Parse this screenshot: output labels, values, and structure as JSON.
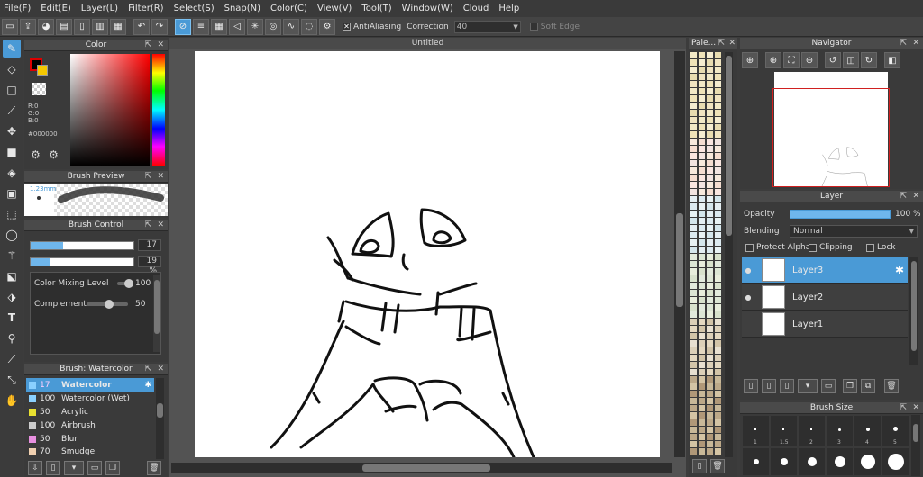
{
  "menu": [
    "File(F)",
    "Edit(E)",
    "Layer(L)",
    "Filter(R)",
    "Select(S)",
    "Snap(N)",
    "Color(C)",
    "View(V)",
    "Tool(T)",
    "Window(W)",
    "Cloud",
    "Help"
  ],
  "toolbar": {
    "antialiasing_label": "AntiAliasing",
    "correction_label": "Correction",
    "correction_value": "40",
    "soft_edge_label": "Soft Edge"
  },
  "color_panel": {
    "title": "Color",
    "r": "R:0",
    "g": "G:0",
    "b": "B:0",
    "hex": "#000000"
  },
  "brush_preview": {
    "title": "Brush Preview",
    "size_label": "1.23mm"
  },
  "brush_control": {
    "title": "Brush Control",
    "size_value": "17",
    "opacity_value": "19 %",
    "size_fraction": 0.32,
    "opacity_fraction": 0.19,
    "mixing_label": "Color Mixing Level",
    "mixing_value": "100",
    "complement_label": "Complement",
    "complement_value": "50"
  },
  "brush_list": {
    "title": "Brush: Watercolor",
    "items": [
      {
        "size": "17",
        "name": "Watercolor",
        "color": "#8ad0ff",
        "selected": true
      },
      {
        "size": "100",
        "name": "Watercolor (Wet)",
        "color": "#8ad0ff",
        "selected": false
      },
      {
        "size": "50",
        "name": "Acrylic",
        "color": "#e8e030",
        "selected": false
      },
      {
        "size": "100",
        "name": "Airbrush",
        "color": "#cccccc",
        "selected": false
      },
      {
        "size": "50",
        "name": "Blur",
        "color": "#e890e0",
        "selected": false
      },
      {
        "size": "70",
        "name": "Smudge",
        "color": "#f0d0b0",
        "selected": false
      }
    ]
  },
  "canvas": {
    "title": "Untitled"
  },
  "palette": {
    "title": "Pale..."
  },
  "navigator": {
    "title": "Navigator"
  },
  "layer_panel": {
    "title": "Layer",
    "opacity_label": "Opacity",
    "opacity_value": "100 %",
    "opacity_fraction": 1.0,
    "blending_label": "Blending",
    "blending_value": "Normal",
    "protect_alpha": "Protect Alpha",
    "clipping": "Clipping",
    "lock": "Lock",
    "layers": [
      "Layer3",
      "Layer2",
      "Layer1"
    ]
  },
  "brush_size": {
    "title": "Brush Size",
    "labels": [
      "1",
      "1.5",
      "2",
      "3",
      "4",
      "5"
    ]
  },
  "colors": {
    "accent": "#4a9ad6",
    "panel": "#3a3a3a"
  }
}
